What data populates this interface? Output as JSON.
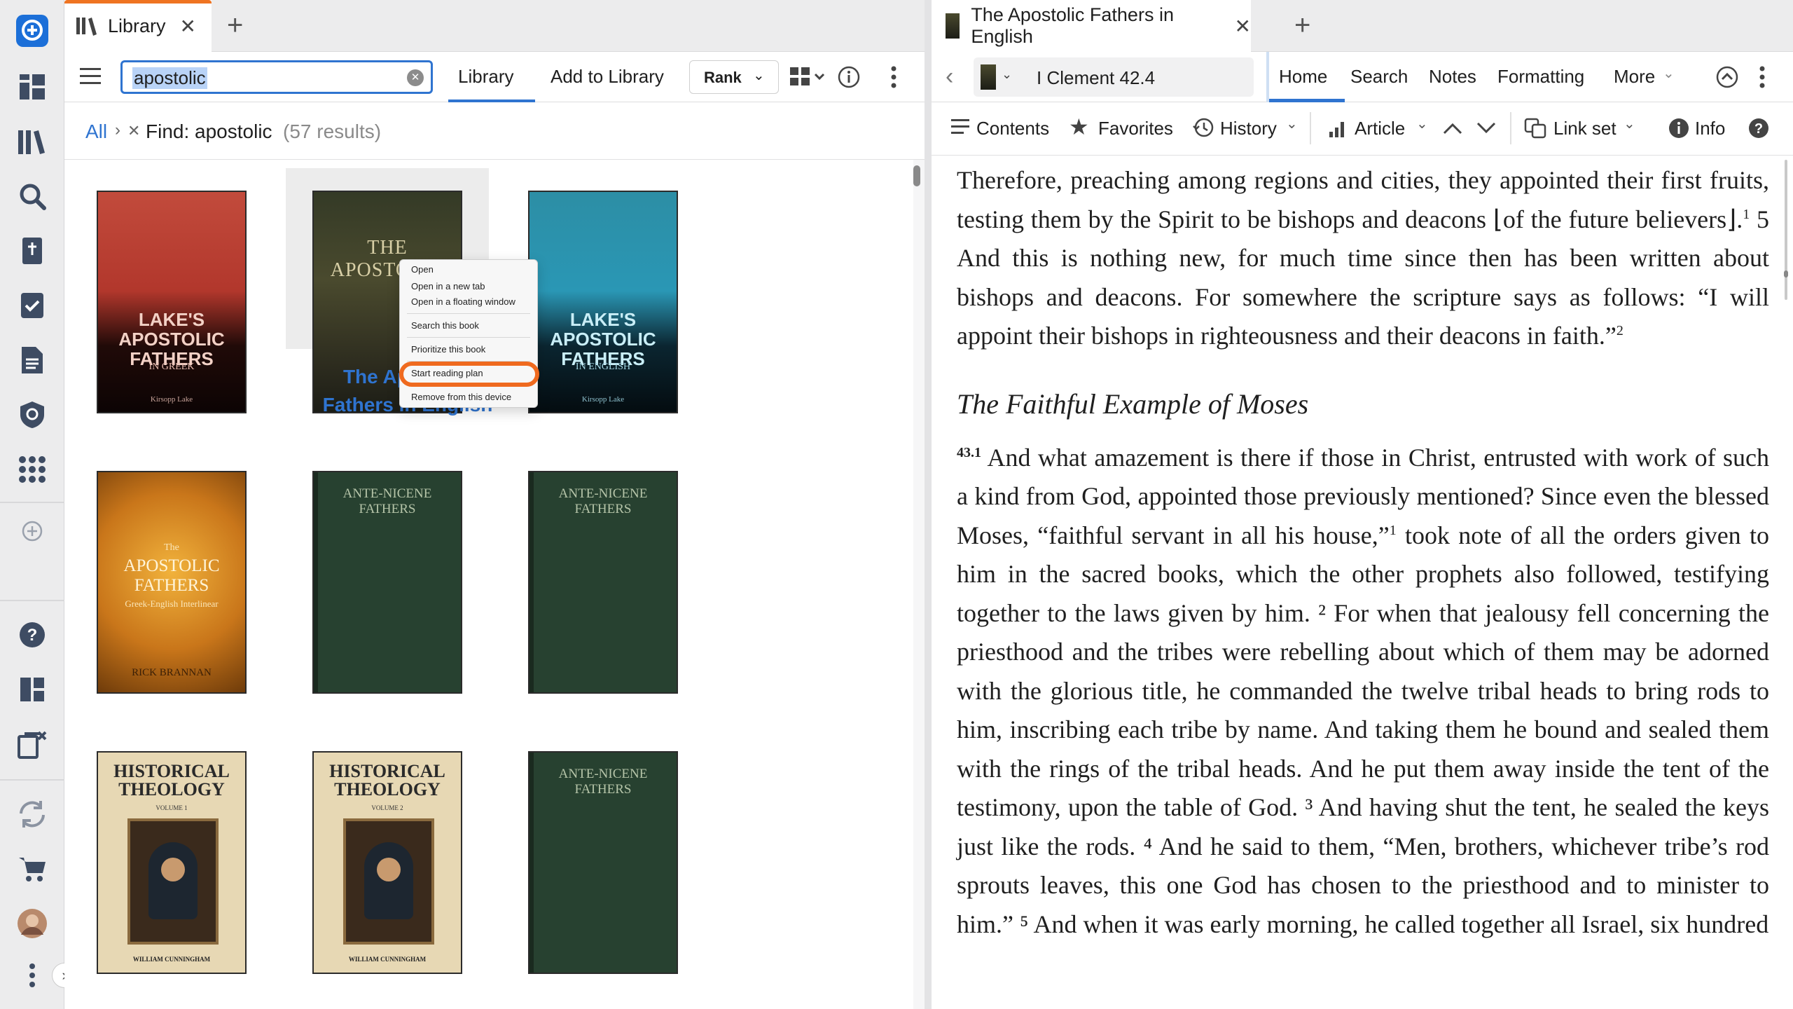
{
  "left_tab": {
    "title": "Library"
  },
  "library_toolbar": {
    "search_value": "apostolic",
    "library_label": "Library",
    "add_label": "Add to Library",
    "sort_label": "Rank"
  },
  "breadcrumb": {
    "all": "All",
    "find_label": "Find: apostolic",
    "results": "(57 results)"
  },
  "books": [
    {
      "title": "LAKE'S APOSTOLIC FATHERS",
      "sub": "IN GREEK",
      "author": "Kirsopp Lake"
    },
    {
      "title": "THE APOSTOLIC",
      "caption_line1": "The Apostolic",
      "caption_line2": "Fathers in English"
    },
    {
      "title": "LAKE'S APOSTOLIC FATHERS",
      "sub": "IN ENGLISH",
      "author": "Kirsopp Lake"
    },
    {
      "small": "The",
      "title": "APOSTOLIC FATHERS",
      "sub": "Greek-English Interlinear",
      "author": "RICK BRANNAN"
    },
    {
      "title": "ANTE-NICENE FATHERS"
    },
    {
      "title": "ANTE-NICENE FATHERS"
    },
    {
      "title": "HISTORICAL THEOLOGY",
      "sub": "VOLUME 1",
      "author": "WILLIAM CUNNINGHAM"
    },
    {
      "title": "HISTORICAL THEOLOGY",
      "sub": "VOLUME 2",
      "author": "WILLIAM CUNNINGHAM"
    },
    {
      "title": "ANTE-NICENE FATHERS"
    }
  ],
  "context_menu": {
    "items": [
      "Open",
      "Open in a new tab",
      "Open in a floating window",
      "Search this book",
      "Prioritize this book",
      "Start reading plan",
      "Remove from this device"
    ]
  },
  "right_tab": {
    "title": "The Apostolic Fathers in English"
  },
  "reader_toolbar": {
    "reference": "I Clement 42.4",
    "tabs": [
      "Home",
      "Search",
      "Notes",
      "Formatting",
      "More"
    ],
    "contents": "Contents",
    "favorites": "Favorites",
    "history": "History",
    "article": "Article",
    "link_set": "Link set",
    "info": "Info"
  },
  "reader": {
    "p1": "Therefore, preaching among regions and cities, they appointed their first fruits, testing them by the Spirit to be bishops and deacons ⌊of the future believers⌋.",
    "p1_fn1": "1",
    "p1b": " 5 And this is nothing new, for much time since then has been written about bishops and deacons. For somewhere the scripture says as follows: “I will appoint their bishops in righteousness and their deacons in faith.”",
    "p1_fn2": "2",
    "heading": "The Faithful Example of Moses",
    "verse": "43.1",
    "p2a": " And what amazement is there if those in Christ, entrusted with work of such a kind from God, appointed those previously mentioned? Since even the blessed Moses, “faithful servant in all his house,”",
    "p2_fn1": "1",
    "p2b": " took note of all the orders given to him in the sacred books, which the other prophets also followed, testifying together to the laws given by him. ² For when that jealousy fell concerning the priesthood and the tribes were rebelling about which of them may be adorned with the glorious title, he commanded the twelve tribal heads to bring rods to him, inscribing each tribe by name. And taking them he bound and sealed them with the rings of the tribal heads. And he put them away inside the tent of the testimony, upon the table of God. ³ And having shut the tent, he sealed the keys just like the rods. ⁴ And he said to them, “Men, brothers, whichever tribe’s rod sprouts leaves, this one God has chosen to the priesthood and to minister to him.” ⁵ And when it was early morning, he called together all Israel, six hundred"
  }
}
